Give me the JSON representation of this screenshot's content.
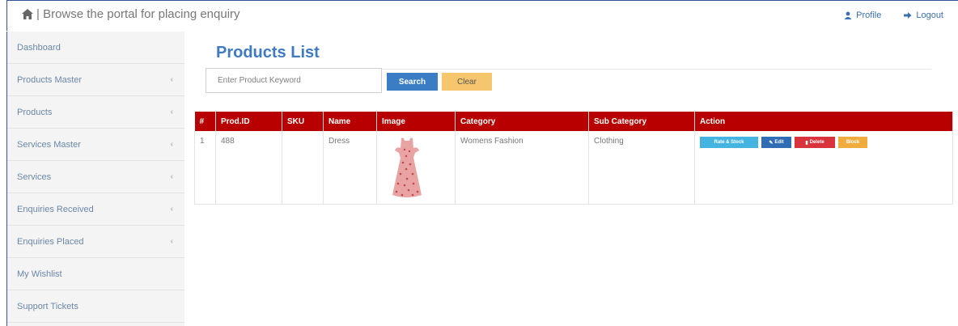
{
  "header": {
    "breadcrumb": "| Browse the portal for placing enquiry",
    "profile_label": "Profile",
    "logout_label": "Logout"
  },
  "sidebar": {
    "items": [
      {
        "label": "Dashboard",
        "has_submenu": false
      },
      {
        "label": "Products Master",
        "has_submenu": true
      },
      {
        "label": "Products",
        "has_submenu": true
      },
      {
        "label": "Services Master",
        "has_submenu": true
      },
      {
        "label": "Services",
        "has_submenu": true
      },
      {
        "label": "Enquiries Received",
        "has_submenu": true
      },
      {
        "label": "Enquiries Placed",
        "has_submenu": true
      },
      {
        "label": "My Wishlist",
        "has_submenu": false
      },
      {
        "label": "Support Tickets",
        "has_submenu": false
      }
    ]
  },
  "main": {
    "title": "Products List",
    "search": {
      "placeholder": "Enter Product Keyword",
      "value": ""
    },
    "search_button": "Search",
    "clear_button": "Clear",
    "table": {
      "headers": [
        "#",
        "Prod.ID",
        "SKU",
        "Name",
        "Image",
        "Category",
        "Sub Category",
        "Action"
      ],
      "rows": [
        {
          "index": "1",
          "prod_id": "488",
          "sku": "",
          "name": "Dress",
          "image_icon": "dress-image",
          "category": "Womens Fashion",
          "sub_category": "Clothing",
          "actions": {
            "rate_stock": "Rate & Stock",
            "edit": "Edit",
            "delete": "Delete",
            "block": "Block"
          }
        }
      ]
    }
  },
  "colors": {
    "accent_blue": "#3b7dc4",
    "table_header_red": "#b80000",
    "clear_orange": "#f6c66f",
    "delete_red": "#d9343b",
    "rate_cyan": "#43b5e0",
    "block_orange": "#f0ad3d"
  }
}
